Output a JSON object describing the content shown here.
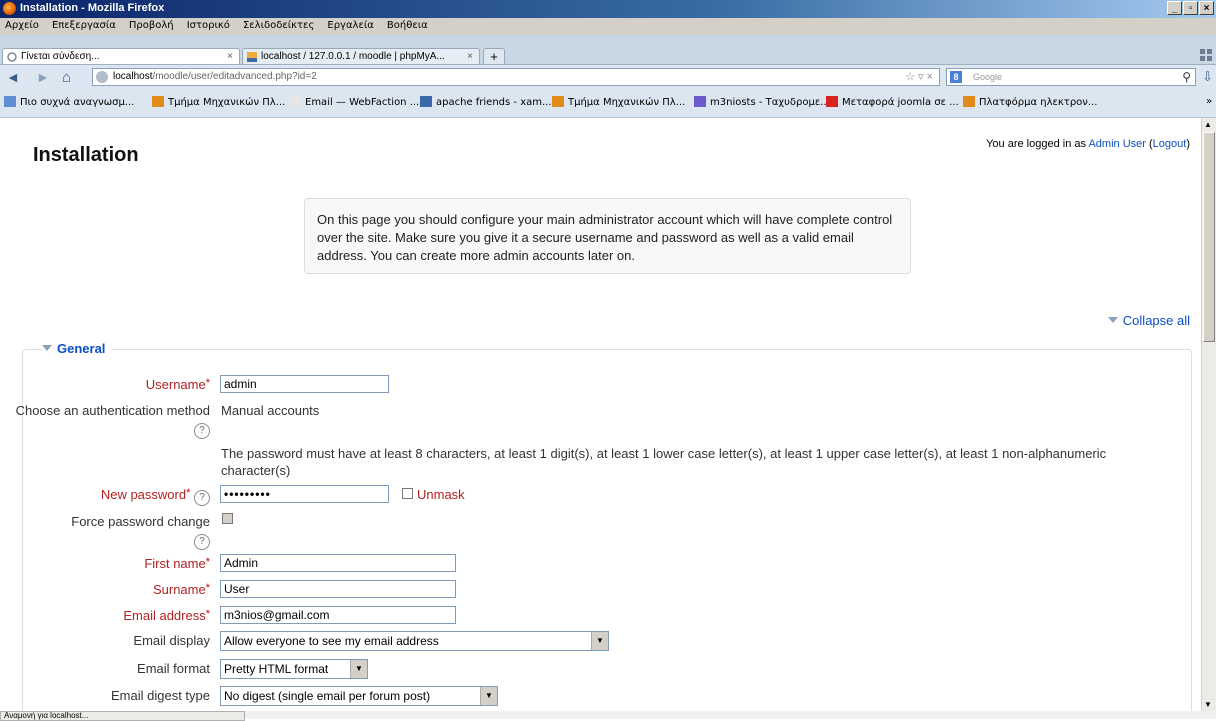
{
  "window": {
    "title": "Installation - Mozilla Firefox",
    "controls": [
      "_",
      "▫",
      "×"
    ]
  },
  "menubar": [
    "Αρχείο",
    "Επεξεργασία",
    "Προβολή",
    "Ιστορικό",
    "Σελιδοδείκτες",
    "Εργαλεία",
    "Βοήθεια"
  ],
  "tabs": [
    {
      "label": "Γίνεται σύνδεση...",
      "close": "×"
    },
    {
      "label": "localhost / 127.0.0.1 / moodle | phpMyA...",
      "close": "×"
    }
  ],
  "newtab_label": "+",
  "navbar": {
    "back": "◄",
    "forward": "►",
    "home": "⌂",
    "url_host": "localhost",
    "url_path": "/moodle/user/editadvanced.php?id=2",
    "url_controls": "☆ ▿ ×",
    "search_engine": "8",
    "search_placeholder": "Google",
    "search_go": "⚲",
    "download": "⇩"
  },
  "bookmarks": [
    "Πιο συχνά αναγνωσμ...",
    "Τμήμα Μηχανικών Πλ...",
    "Email — WebFaction ...",
    "apache friends - xam...",
    "Τμήμα Μηχανικών Πλ...",
    "m3niosts - Ταχυδρομε...",
    "Μεταφορά joomla σε ...",
    "Πλατφόρμα ηλεκτρον..."
  ],
  "bookmarks_more": "»",
  "page": {
    "title": "Installation",
    "login_prefix": "You are logged in as",
    "login_user": "Admin User",
    "logout_label": "Logout",
    "notice": "On this page you should configure your main administrator account which will have complete control over the site. Make sure you give it a secure username and password as well as a valid email address. You can create more admin accounts later on.",
    "collapse_all": "Collapse all",
    "section": "General"
  },
  "form": {
    "username_label": "Username",
    "username_value": "admin",
    "auth_label": "Choose an authentication method",
    "auth_value": "Manual accounts",
    "password_rule": "The password must have at least 8 characters, at least 1 digit(s), at least 1 lower case letter(s), at least 1 upper case letter(s), at least 1 non-alphanumeric character(s)",
    "password_label": "New password",
    "password_value": "•••••••••",
    "unmask_label": "Unmask",
    "force_label": "Force password change",
    "firstname_label": "First name",
    "firstname_value": "Admin",
    "surname_label": "Surname",
    "surname_value": "User",
    "email_label": "Email address",
    "email_value": "m3nios@gmail.com",
    "emaildisplay_label": "Email display",
    "emaildisplay_value": "Allow everyone to see my email address",
    "emailformat_label": "Email format",
    "emailformat_value": "Pretty HTML format",
    "digest_label": "Email digest type",
    "digest_value": "No digest (single email per forum post)",
    "required_mark": "*",
    "help_mark": "?"
  },
  "status_text": "Αναμονή για localhost..."
}
